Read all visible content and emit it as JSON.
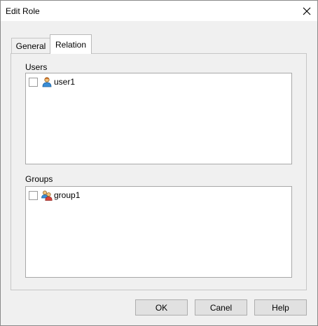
{
  "window": {
    "title": "Edit Role",
    "close_icon": "close-icon"
  },
  "tabs": [
    {
      "label": "General",
      "selected": false
    },
    {
      "label": "Relation",
      "selected": true
    }
  ],
  "users": {
    "label": "Users",
    "items": [
      {
        "name": "user1",
        "checked": false,
        "icon": "user-icon"
      }
    ]
  },
  "groups": {
    "label": "Groups",
    "items": [
      {
        "name": "group1",
        "checked": false,
        "icon": "group-icon"
      }
    ]
  },
  "buttons": {
    "ok": "OK",
    "cancel": "Canel",
    "help": "Help"
  }
}
